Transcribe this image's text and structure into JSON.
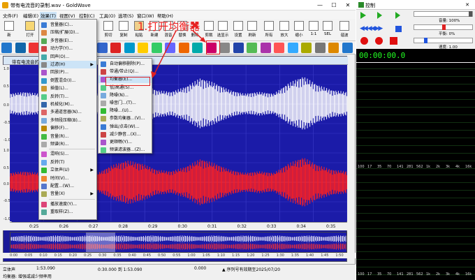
{
  "app": {
    "title": "带有电流音的录制.wav - GoldWave",
    "win_min": "—",
    "win_max": "☐",
    "win_close": "✕"
  },
  "menubar": [
    "文件(F)",
    "编辑(E)",
    "效果(T)",
    "视图(V)",
    "控制(C)",
    "工具(O)",
    "选项(S)",
    "窗口(W)",
    "帮助(H)"
  ],
  "toolbar1": [
    "新",
    "打开",
    "保存",
    "撤消",
    "重做",
    "剪切",
    "复制",
    "粘贴",
    "新建",
    "混音",
    "替换",
    "删除",
    "剪裁",
    "选显示",
    "设置",
    "刷新",
    "所有",
    "放大",
    "缩小",
    "1:1",
    "SEL",
    "谐波"
  ],
  "annotation": "1.打开均衡器",
  "document": {
    "title": "带有电流音的录制.wav"
  },
  "scale_top": [
    "1.0",
    "0.5",
    "0.0",
    "-0.5",
    "-1.0"
  ],
  "scale_bottom": [
    "1.0",
    "0.5",
    "0.0",
    "-0.5",
    "-1.0"
  ],
  "timeline": [
    "0:25",
    "0:26",
    "0:27",
    "0:28",
    "0:29",
    "0:30",
    "0:31",
    "0:32",
    "0:33",
    "0:34",
    "0:35"
  ],
  "overview_time": [
    "0:00",
    "0:05",
    "0:10",
    "0:15",
    "0:20",
    "0:25",
    "0:30",
    "0:35",
    "0:40",
    "0:45",
    "0:50",
    "0:55",
    "1:00",
    "1:05",
    "1:10",
    "1:15",
    "1:20",
    "1:25",
    "1:30",
    "1:35",
    "1:40",
    "1:45",
    "1:50"
  ],
  "effects_menu": [
    {
      "label": "音量器(C)...",
      "arrow": false
    },
    {
      "label": "压缩/扩展(D)...",
      "arrow": false
    },
    {
      "label": "多音器(E)...",
      "arrow": false
    },
    {
      "label": "动力学(Y)...",
      "arrow": false
    },
    {
      "label": "回声(O)...",
      "arrow": false
    },
    {
      "label": "过滤(H)",
      "arrow": true
    },
    {
      "label": "回放(P)...",
      "arrow": false
    },
    {
      "label": "倒置混合(I)...",
      "arrow": false
    },
    {
      "label": "插值(L)...",
      "arrow": false
    },
    {
      "label": "反转(T)...",
      "arrow": false
    },
    {
      "label": "机械化(M)...",
      "arrow": false
    },
    {
      "label": "多通道音器(N)...",
      "arrow": false
    },
    {
      "label": "多频段压缩(B)...",
      "arrow": false
    },
    {
      "label": "偏移(F)...",
      "arrow": false
    },
    {
      "label": "音量(R)...",
      "arrow": false
    },
    {
      "label": "频谱(R)...",
      "arrow": false
    },
    {
      "label": "混响(S)...",
      "arrow": false
    },
    {
      "label": "反转(T)",
      "arrow": false
    },
    {
      "label": "立体声(U)",
      "arrow": true
    },
    {
      "label": "时间(V)...",
      "arrow": false
    },
    {
      "label": "配置...(W)...",
      "arrow": false
    },
    {
      "label": "音量(X)",
      "arrow": true
    },
    {
      "label": "播放速度(Y)...",
      "arrow": false
    },
    {
      "label": "重取样(Z)...",
      "arrow": false
    }
  ],
  "filter_menu": [
    {
      "label": "自动偏移删除(P)...",
      "highlight": false
    },
    {
      "label": "带通/带止(Q)...",
      "highlight": false
    },
    {
      "label": "均衡器(E)...",
      "highlight": true
    },
    {
      "label": "低/高通(S)...",
      "highlight": false
    },
    {
      "label": "降噪(N)...",
      "highlight": false
    },
    {
      "label": "噪音门...(T)...",
      "highlight": false
    },
    {
      "label": "降噪...(U)...",
      "highlight": false
    },
    {
      "label": "参数均衡器...(V)...",
      "highlight": false
    },
    {
      "label": "弹出/点击(W)...",
      "highlight": false
    },
    {
      "label": "减少静音...(X)...",
      "highlight": false
    },
    {
      "label": "更顺畅(Y)...",
      "highlight": false
    },
    {
      "label": "频谱滤波器...(Z)...",
      "highlight": false
    }
  ],
  "status": {
    "channel": "立体声",
    "total": "1:53.090",
    "selection": "0:30.000 到 1:53.090",
    "position": "0.000",
    "message": "▲ 序列号有效期至2025/07/20",
    "bottom": "均衡器: 增强或减少频率用"
  },
  "control": {
    "title": "控制",
    "volume": "音量: 100%",
    "balance": "平衡: 0%",
    "speed": "速度: 1.00",
    "time": "00:00:00.0",
    "freq_labels": [
      "100",
      "17",
      "35",
      "70",
      "141",
      "281",
      "562",
      "1k",
      "2k",
      "3k",
      "4k",
      "16k"
    ],
    "freq_labels2": [
      "100",
      "17",
      "35",
      "70",
      "141",
      "281",
      "562",
      "1k",
      "2k",
      "3k",
      "4k",
      "16k"
    ],
    "db_labels": [
      "-1",
      "-3",
      "-6",
      "-9",
      "-12",
      "-18",
      "-24",
      "-30",
      "-36",
      "-48"
    ]
  },
  "colors": {
    "wave_top": "#ffffff",
    "wave_bottom": "#ff2020",
    "wave_bg": "#1b1ba8",
    "annotation": "#ee2222",
    "play_green": "#22aa22",
    "menu_highlight": "#cce4f7"
  }
}
